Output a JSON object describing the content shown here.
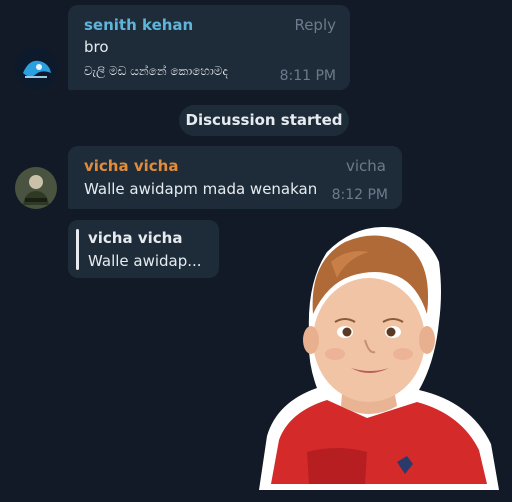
{
  "messages": [
    {
      "sender": "senith kehan",
      "action": "Reply",
      "lines": [
        "bro",
        "වැලි මඩ යන්නේ කොහොමද"
      ],
      "time": "8:11 PM"
    },
    {
      "sender": "vicha vicha",
      "role": "vicha",
      "text": "Walle  awidapm mada wenakan",
      "time": "8:12 PM"
    }
  ],
  "service_message": "Discussion started",
  "reply_preview": {
    "sender": "vicha vicha",
    "text": "Walle  awidap..."
  },
  "sticker": {
    "subject": "crying-kid-sticker"
  },
  "colors": {
    "background": "#111a26",
    "bubble": "#1e2c3a",
    "sender_blue": "#5fb4d9",
    "sender_orange": "#e08c3c",
    "meta_gray": "#6b7b8c"
  }
}
